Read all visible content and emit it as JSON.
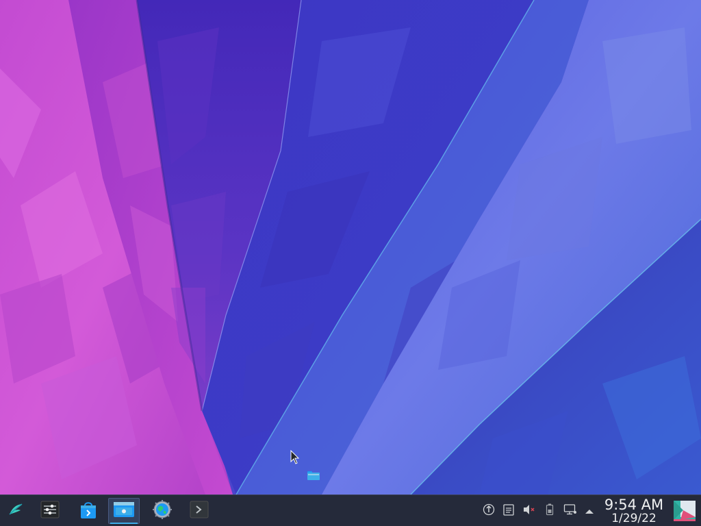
{
  "desktop": {
    "wallpaper_name": "kde-plasma-polygon-wallpaper",
    "folder_icon": "folder-icon",
    "cursor_icon": "mouse-pointer-icon"
  },
  "panel": {
    "launcher_icon": "application-launcher-icon",
    "tasks": [
      {
        "icon": "system-settings-sliders-icon"
      },
      {
        "icon": "discover-store-icon"
      },
      {
        "icon": "dolphin-file-manager-icon",
        "active": true
      },
      {
        "icon": "web-browser-globe-icon"
      },
      {
        "icon": "konsole-terminal-icon"
      }
    ],
    "tray": [
      {
        "icon": "update-notifier-icon"
      },
      {
        "icon": "clipboard-icon"
      },
      {
        "icon": "volume-muted-icon"
      },
      {
        "icon": "battery-icon"
      },
      {
        "icon": "network-monitor-icon"
      },
      {
        "icon": "show-hidden-icons-chevron-up-icon"
      }
    ],
    "clock": {
      "time": "9:54 AM",
      "date": "1/29/22"
    },
    "pager_icon": "virtual-desktop-pager-icon"
  },
  "colors": {
    "panel_bg": "#252a3a",
    "accent": "#3daee9",
    "wallpaper_pink": "#d04ad0",
    "wallpaper_violet": "#5a2ec0",
    "wallpaper_blue": "#5b6fe0"
  }
}
